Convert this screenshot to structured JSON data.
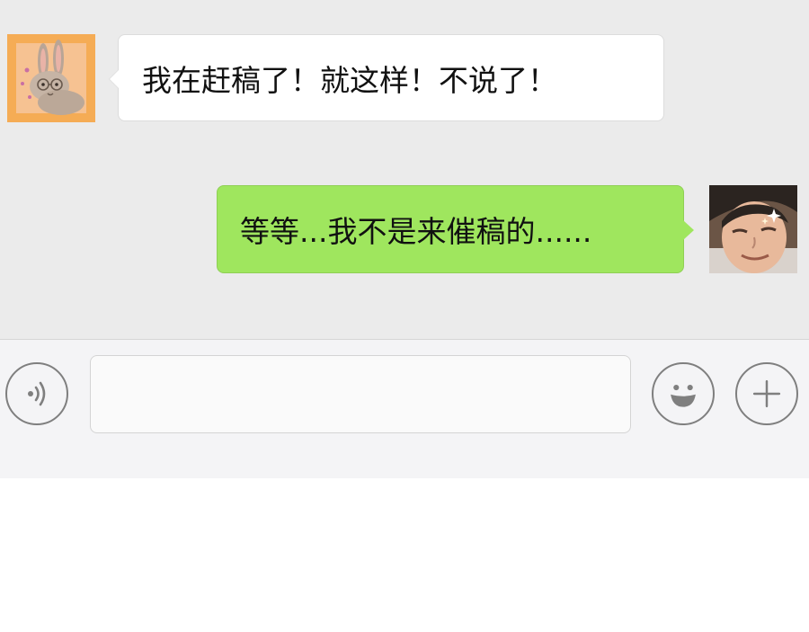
{
  "messages": [
    {
      "side": "left",
      "sender": "rabbit",
      "text": "我在赶稿了！就这样！不说了！"
    },
    {
      "side": "right",
      "sender": "man",
      "text": "等等...我不是来催稿的......"
    }
  ],
  "input": {
    "value": "",
    "placeholder": ""
  },
  "icons": {
    "voice": "voice-icon",
    "emoji": "emoji-icon",
    "plus": "plus-icon"
  },
  "colors": {
    "chat_background": "#ebebeb",
    "outgoing_bubble": "#9fe65e",
    "incoming_bubble": "#ffffff",
    "input_bar": "#f4f4f6"
  }
}
